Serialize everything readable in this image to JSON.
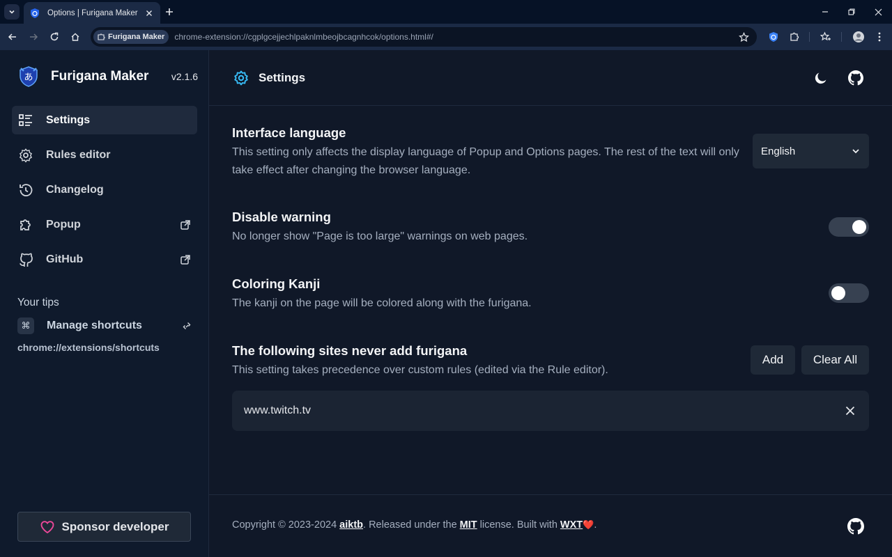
{
  "browser": {
    "tab_title": "Options | Furigana Maker",
    "site_chip": "Furigana Maker",
    "url": "chrome-extension://cgplgcejjechlpaknlmbeojbcagnhcok/options.html#/"
  },
  "sidebar": {
    "app_name": "Furigana Maker",
    "version": "v2.1.6",
    "items": [
      {
        "label": "Settings",
        "icon": "list-settings-icon",
        "active": true
      },
      {
        "label": "Rules editor",
        "icon": "gear-icon"
      },
      {
        "label": "Changelog",
        "icon": "history-icon"
      },
      {
        "label": "Popup",
        "icon": "puzzle-icon",
        "external": true
      },
      {
        "label": "GitHub",
        "icon": "github-icon",
        "external": true
      }
    ],
    "tips": {
      "title": "Your tips",
      "shortcut_key": "⌘",
      "shortcut_label": "Manage shortcuts",
      "shortcut_url": "chrome://extensions/shortcuts"
    },
    "sponsor_label": "Sponsor developer"
  },
  "header": {
    "title": "Settings"
  },
  "settings": {
    "language": {
      "title": "Interface language",
      "description": "This setting only affects the display language of Popup and Options pages. The rest of the text will only take effect after changing the browser language.",
      "selected": "English"
    },
    "disable_warning": {
      "title": "Disable warning",
      "description": "No longer show \"Page is too large\" warnings on web pages.",
      "enabled": true
    },
    "coloring_kanji": {
      "title": "Coloring Kanji",
      "description": "The kanji on the page will be colored along with the furigana.",
      "enabled": false
    },
    "blocked_sites": {
      "title": "The following sites never add furigana",
      "description": "This setting takes precedence over custom rules (edited via the Rule editor).",
      "add_label": "Add",
      "clear_label": "Clear All",
      "sites": [
        "www.twitch.tv"
      ]
    }
  },
  "footer": {
    "copyright": "Copyright © 2023-2024",
    "author": "aiktb",
    "released": ". Released under the",
    "license": "MIT",
    "built": "license. Built with",
    "framework": "WXT",
    "heart": "❤️",
    "end": "."
  },
  "colors": {
    "accent": "#38bdf8",
    "background": "#101828",
    "sidebar": "#0f1a2c",
    "toggle_on": "#374151",
    "sponsor_heart": "#ec4899"
  }
}
